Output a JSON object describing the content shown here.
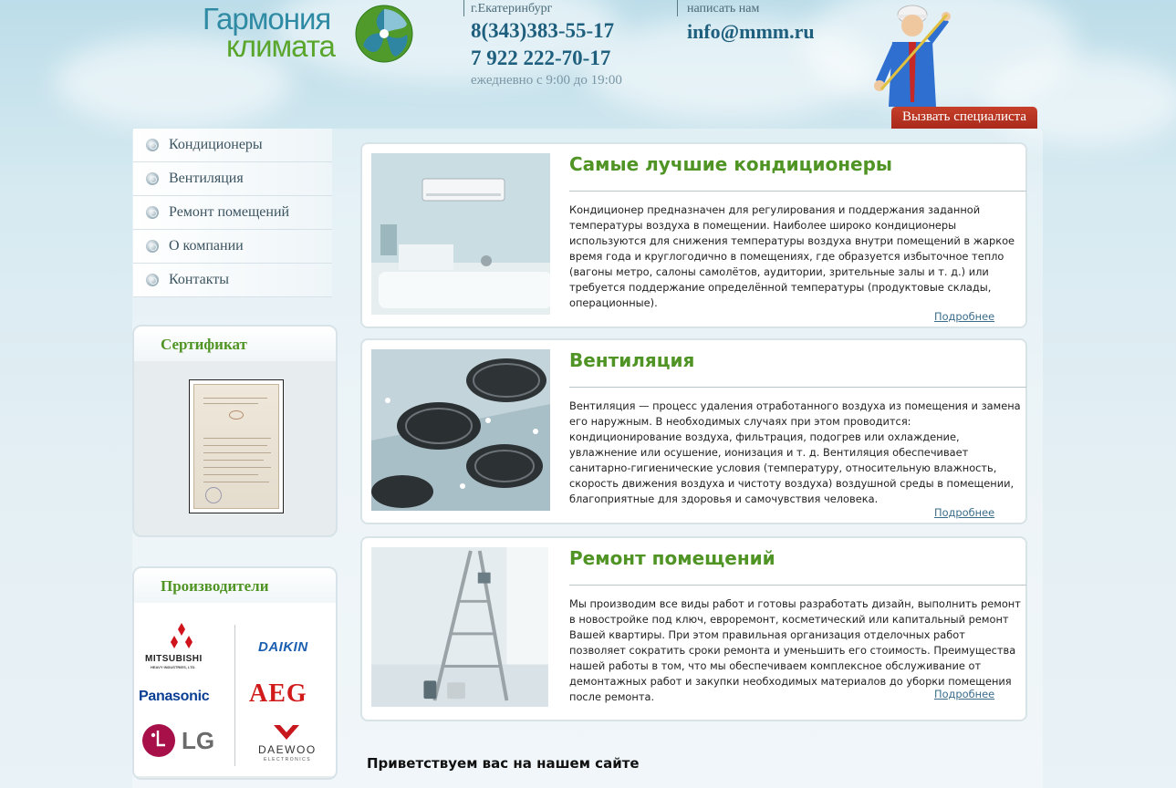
{
  "header": {
    "logo": {
      "line1": "Гармония",
      "line2": "климата"
    },
    "city": "г.Екатеринбург",
    "phone1": "8(343)383-55-17",
    "phone2": "7 922 222-70-17",
    "hours": "ежедневно с 9:00 до 19:00",
    "write_label": "написать нам",
    "email": "info@mmm.ru",
    "call_button": "Вызвать специалиста"
  },
  "menu": {
    "items": [
      {
        "label": "Кондиционеры"
      },
      {
        "label": "Вентиляция"
      },
      {
        "label": "Ремонт помещений"
      },
      {
        "label": "О компании"
      },
      {
        "label": "Контакты"
      }
    ]
  },
  "certificate": {
    "title": "Сертификат"
  },
  "manufacturers": {
    "title": "Производители",
    "brands": [
      "MITSUBISHI",
      "HEAVY INDUSTRIES, LTD.",
      "DAIKIN",
      "Panasonic",
      "AEG",
      "LG",
      "DAEWOO",
      "ELECTRONICS"
    ]
  },
  "articles": [
    {
      "title": "Самые лучшие кондиционеры",
      "text": "Кондиционер предназначен для регулирования и поддержания заданной температуры воздуха в помещении. Наиболее широко кондиционеры используются для снижения температуры воздуха внутри помещений в жаркое время года и круглогодично в помещениях, где образуется избыточное тепло (вагоны метро, салоны самолётов, аудитории, зрительные залы и т. д.) или требуется поддержание определённой температуры (продуктовые склады, операционные).",
      "more": "Подробнее"
    },
    {
      "title": "Вентиляция",
      "text": "Вентиляция — процесс удаления отработанного воздуха из помещения и замена его наружным. В необходимых случаях при этом проводится: кондиционирование воздуха, фильтрация, подогрев или охлаждение, увлажнение или осушение, ионизация и т. д. Вентиляция обеспечивает санитарно-гигиенические условия (температуру, относительную влажность, скорость движения воздуха и чистоту воздуха) воздушной среды в помещении, благоприятные для здоровья и самочувствия человека.",
      "more": "Подробнее"
    },
    {
      "title": "Ремонт помещений",
      "text": "Мы производим все виды работ и готовы разработать дизайн, выполнить ремонт в новостройке под ключ, евроремонт, косметический или капитальный ремонт Вашей квартиры. При этом правильная организация отделочных работ позволяет сократить сроки ремонта и уменьшить его стоимость. Преимущества нашей работы в том, что мы обеспечиваем комплексное обслуживание от демонтажных работ и закупки необходимых материалов до уборки помещения после ремонта.",
      "more": "Подробнее"
    }
  ],
  "welcome": "Приветствуем вас на нашем сайте",
  "colors": {
    "accent_green": "#4f9424",
    "brand_blue": "#1f5f7e",
    "call_red": "#b3311f"
  }
}
